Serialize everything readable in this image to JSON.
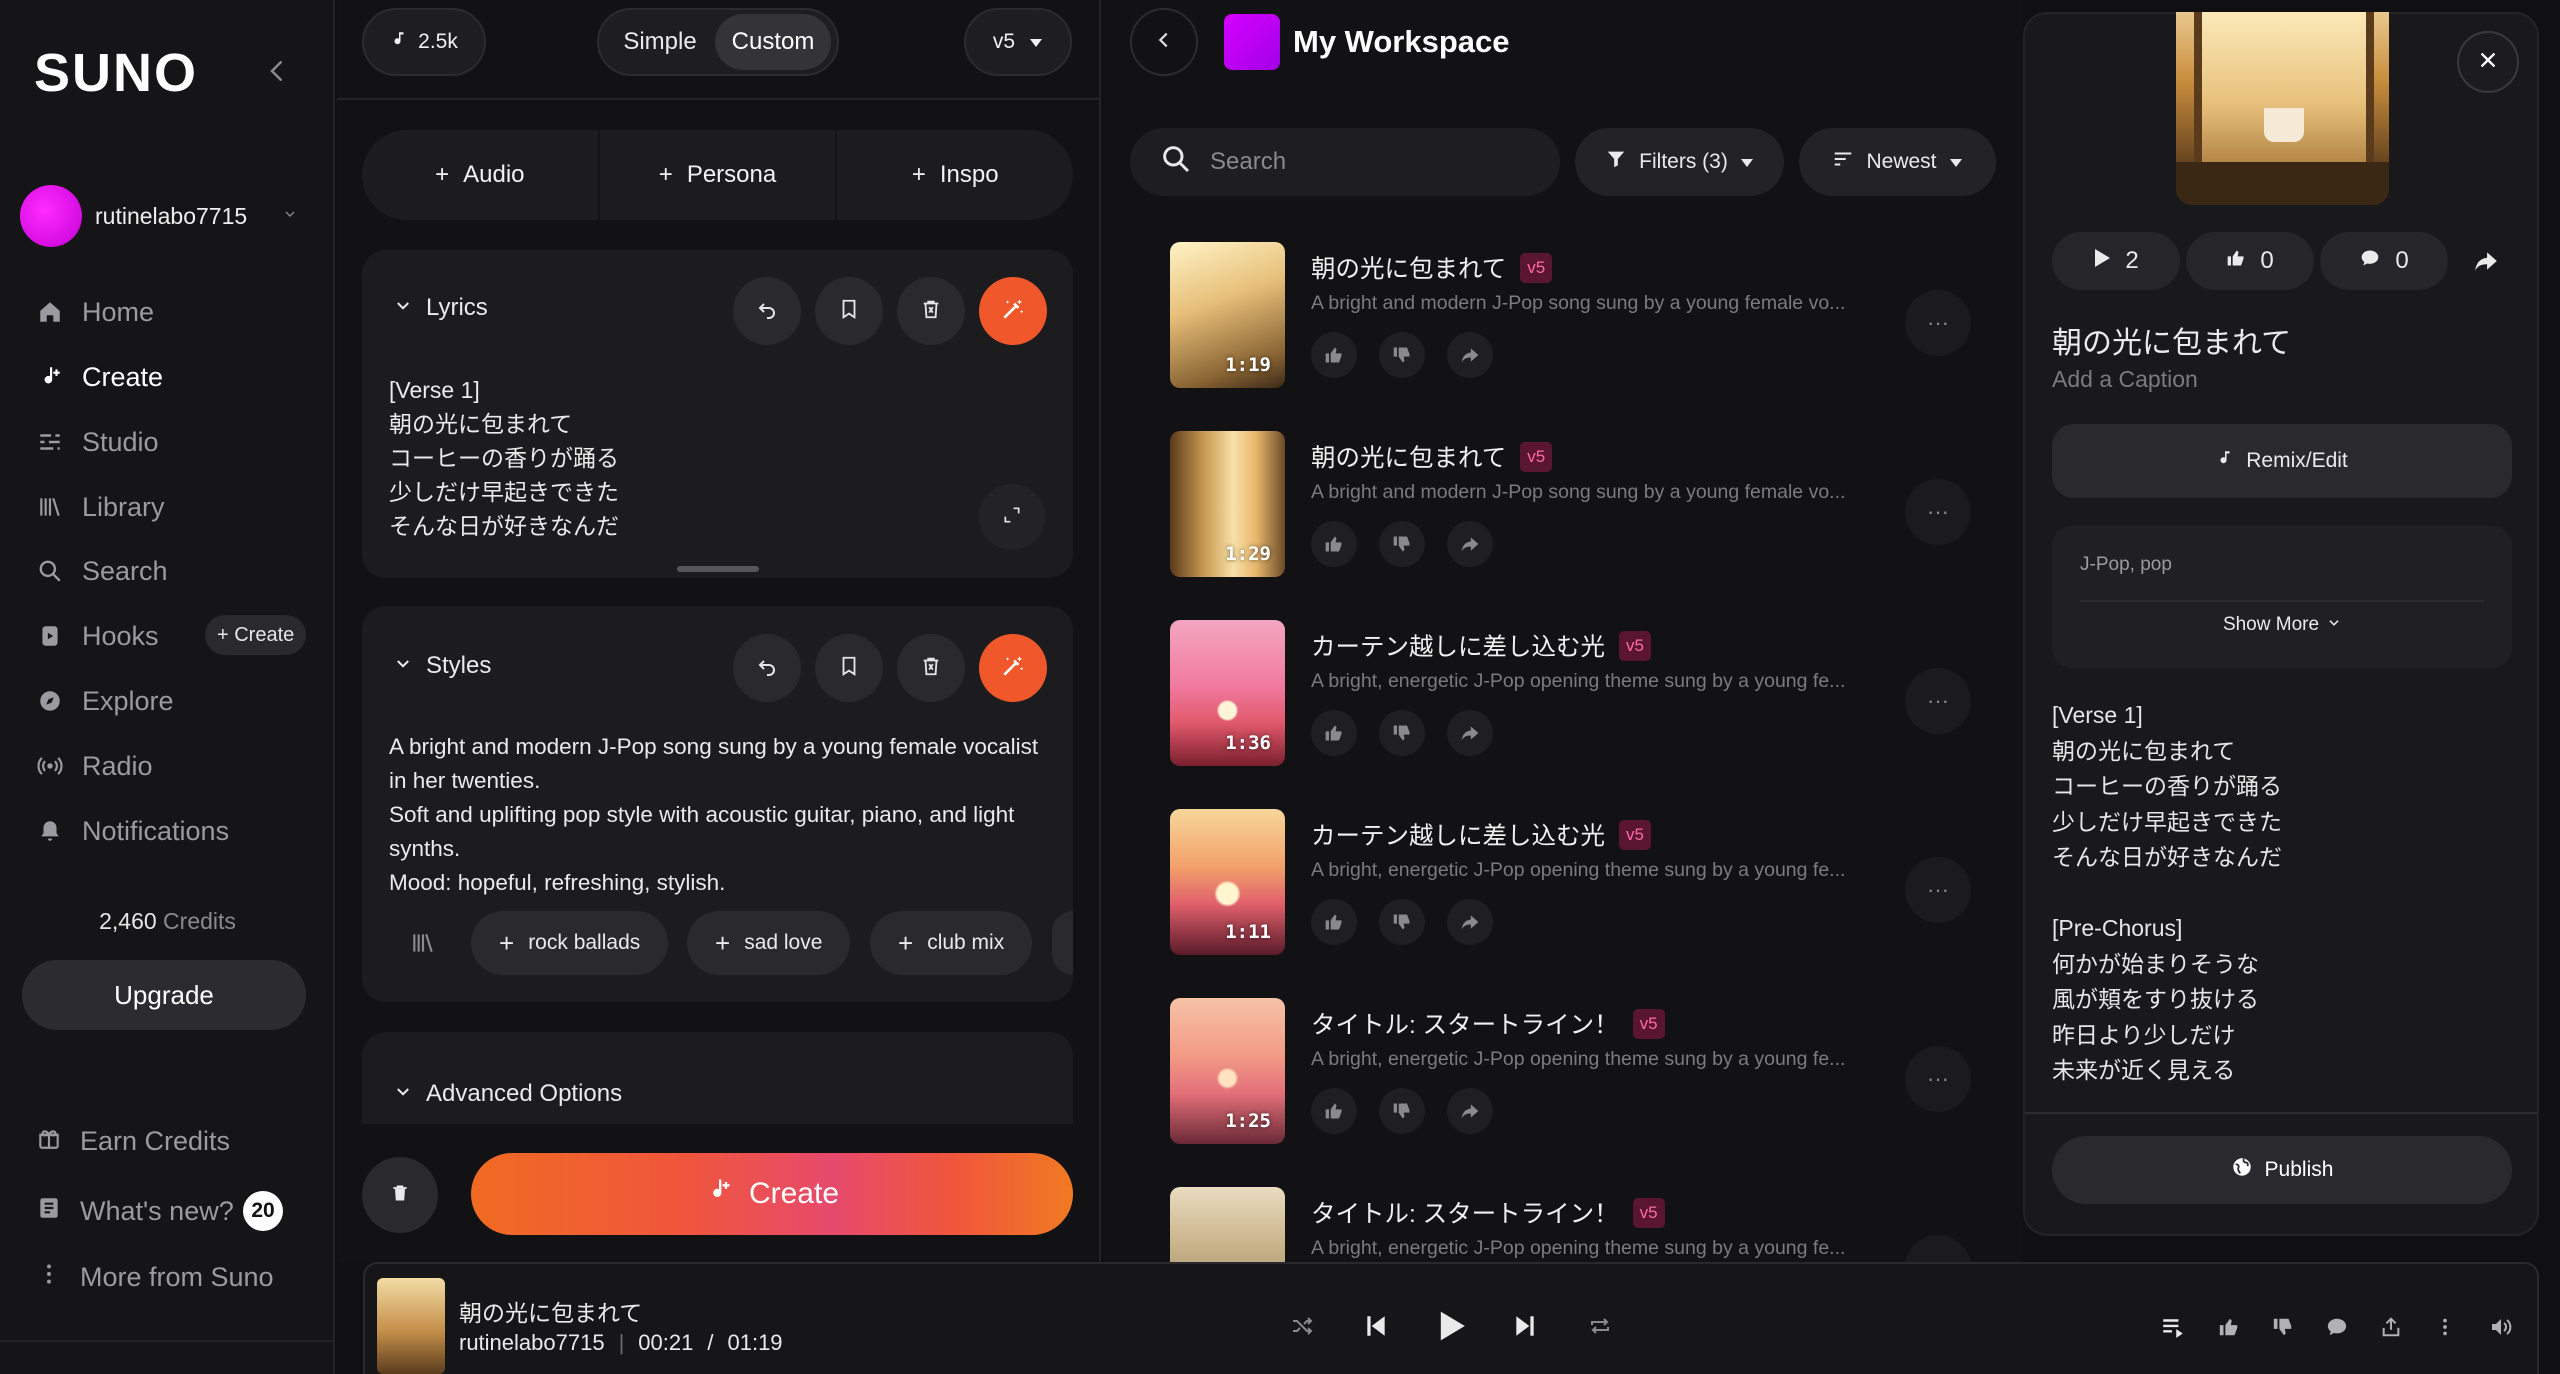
{
  "sidebar": {
    "logo": "SUNO",
    "username": "rutinelabo7715",
    "nav": [
      {
        "label": "Home",
        "icon": "home-icon"
      },
      {
        "label": "Create",
        "icon": "music-note-plus-icon"
      },
      {
        "label": "Studio",
        "icon": "sliders-icon"
      },
      {
        "label": "Library",
        "icon": "library-icon"
      },
      {
        "label": "Search",
        "icon": "search-icon"
      },
      {
        "label": "Hooks",
        "icon": "hooks-icon"
      },
      {
        "label": "Explore",
        "icon": "compass-icon"
      },
      {
        "label": "Radio",
        "icon": "radio-icon"
      },
      {
        "label": "Notifications",
        "icon": "bell-icon"
      }
    ],
    "hooks_create_label": "+ Create",
    "credits_value": "2,460",
    "credits_label": "Credits",
    "upgrade_label": "Upgrade",
    "footer": [
      {
        "label": "Earn Credits",
        "icon": "gift-icon"
      },
      {
        "label": "What's new?",
        "icon": "news-icon"
      },
      {
        "label": "More from Suno",
        "icon": "more-vertical-icon"
      }
    ],
    "whats_new_badge": "20"
  },
  "create": {
    "credits_chip": "2.5k",
    "mode_simple": "Simple",
    "mode_custom": "Custom",
    "model": "v5",
    "add_audio": "Audio",
    "add_persona": "Persona",
    "add_inspo": "Inspo",
    "lyrics_title": "Lyrics",
    "lyrics_lines": [
      "[Verse 1]",
      "朝の光に包まれて",
      "コーヒーの香りが踊る",
      "少しだけ早起きできた",
      "そんな日が好きなんだ"
    ],
    "styles_title": "Styles",
    "styles_lines": [
      "A bright and modern J-Pop song sung by a young female vocalist",
      "in her twenties.",
      "Soft and uplifting pop style with acoustic guitar, piano, and light",
      "synths.",
      "Mood: hopeful, refreshing, stylish."
    ],
    "style_tags": [
      "rock ballads",
      "sad love",
      "club mix"
    ],
    "advanced_label": "Advanced Options",
    "create_label": "Create"
  },
  "workspace": {
    "title": "My Workspace",
    "search_placeholder": "Search",
    "filters_label": "Filters (3)",
    "sort_label": "Newest",
    "songs": [
      {
        "title": "朝の光に包まれて",
        "version": "v5",
        "desc": "A bright and modern J-Pop song sung by a young female vo...",
        "duration": "1:19"
      },
      {
        "title": "朝の光に包まれて",
        "version": "v5",
        "desc": "A bright and modern J-Pop song sung by a young female vo...",
        "duration": "1:29"
      },
      {
        "title": "カーテン越しに差し込む光",
        "version": "v5",
        "desc": "A bright, energetic J-Pop opening theme sung by a young fe...",
        "duration": "1:36"
      },
      {
        "title": "カーテン越しに差し込む光",
        "version": "v5",
        "desc": "A bright, energetic J-Pop opening theme sung by a young fe...",
        "duration": "1:11"
      },
      {
        "title": "タイトル: スタートライン！",
        "version": "v5",
        "desc": "A bright, energetic J-Pop opening theme sung by a young fe...",
        "duration": "1:25"
      },
      {
        "title": "タイトル: スタートライン！",
        "version": "v5",
        "desc": "A bright, energetic J-Pop opening theme sung by a young fe...",
        "duration": ""
      }
    ]
  },
  "detail": {
    "plays": "2",
    "likes": "0",
    "comments": "0",
    "title": "朝の光に包まれて",
    "caption": "Add a Caption",
    "remix_label": "Remix/Edit",
    "tags": "J-Pop, pop",
    "show_more": "Show More",
    "lyrics": "[Verse 1]\n朝の光に包まれて\nコーヒーの香りが踊る\n少しだけ早起きできた\nそんな日が好きなんだ\n\n[Pre-Chorus]\n何かが始まりそうな\n風が頬をすり抜ける\n昨日より少しだけ\n未来が近く見える",
    "publish_label": "Publish"
  },
  "player": {
    "title": "朝の光に包まれて",
    "artist": "rutinelabo7715",
    "separator": "|",
    "current": "00:21",
    "slash": "/",
    "total": "01:19"
  },
  "colors": {
    "accent_orange": "#f0582b",
    "avatar_magenta": "#e600ff",
    "v5_badge": "#ff6aa6"
  }
}
